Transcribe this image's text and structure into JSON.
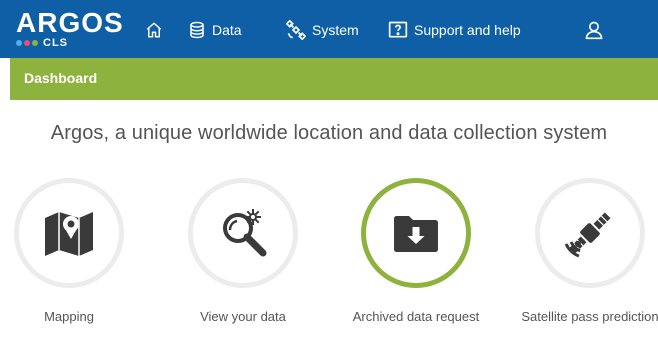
{
  "header": {
    "logo": {
      "name": "ARGOS",
      "sub": "CLS"
    },
    "nav": [
      {
        "label": "",
        "icon": "home-icon"
      },
      {
        "label": "Data",
        "icon": "database-icon"
      },
      {
        "label": "System",
        "icon": "satellite-icon"
      },
      {
        "label": "Support and help",
        "icon": "help-icon"
      },
      {
        "label": "",
        "icon": "user-icon"
      }
    ]
  },
  "subheader": {
    "title": "Dashboard"
  },
  "main": {
    "headline": "Argos, a unique worldwide location and data collection system",
    "cards": [
      {
        "label": "Mapping",
        "icon": "map-pin-icon",
        "active": false
      },
      {
        "label": "View your data",
        "icon": "magnifier-icon",
        "active": false
      },
      {
        "label": "Archived data request",
        "icon": "folder-download-icon",
        "active": true
      },
      {
        "label": "Satellite pass prediction",
        "icon": "satellite-icon",
        "active": false
      }
    ]
  },
  "colors": {
    "topbar": "#0f5fa7",
    "accent_green": "#8db33e",
    "circle_border": "#ececec",
    "icon_dark": "#3a3a3a",
    "text_gray": "#555555"
  }
}
